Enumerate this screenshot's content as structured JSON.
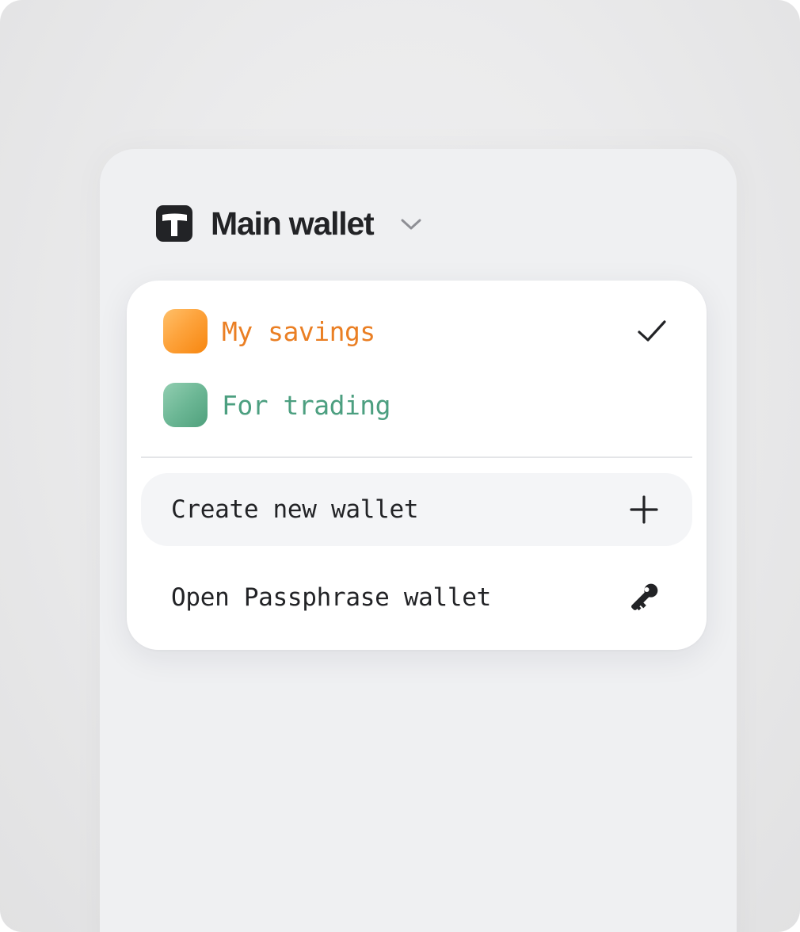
{
  "header": {
    "title": "Main wallet",
    "logo_icon": "app-logo-icon",
    "dropdown_icon": "chevron-down-icon"
  },
  "wallets": [
    {
      "name": "My savings",
      "color": "#ea7f24",
      "selected": true,
      "check_icon": "checkmark-icon"
    },
    {
      "name": "For trading",
      "color": "#4c9f80",
      "selected": false
    }
  ],
  "actions": {
    "create": {
      "label": "Create new wallet",
      "icon": "plus-icon"
    },
    "open": {
      "label": "Open Passphrase wallet",
      "icon": "key-icon"
    }
  }
}
